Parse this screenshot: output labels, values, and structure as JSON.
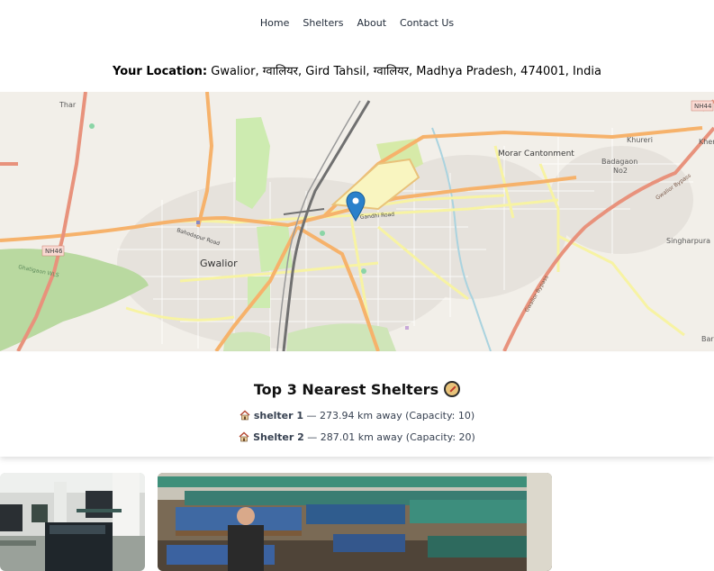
{
  "nav": {
    "home": "Home",
    "shelters": "Shelters",
    "about": "About",
    "contact": "Contact Us"
  },
  "location": {
    "label": "Your Location:",
    "value": "Gwalior, ग्वालियर, Gird Tahsil, ग्वालियर, Madhya Pradesh, 474001, India"
  },
  "map": {
    "labels": {
      "thar": "Thar",
      "nh44": "NH44",
      "khureri": "Khureri",
      "morar_cantonment": "Morar Cantonment",
      "badagaon": "Badagaon",
      "no2": "No2",
      "gwalior_bypass_1": "Gwalior Bypass",
      "singharpura": "Singharpura",
      "gandhi_road": "Gandhi Road",
      "bahodapur_road": "Bahodapur Road",
      "nh46": "NH46",
      "gwalior": "Gwalior",
      "ghatigaon": "Ghatigaon WLS",
      "gwalior_bypass_2": "Gwalior Bypass",
      "khere": "Khere",
      "bar": "Bar"
    }
  },
  "nearest": {
    "title": "Top 3 Nearest Shelters",
    "items": [
      {
        "name": "shelter 1",
        "detail": " — 273.94 km away (Capacity: 10)"
      },
      {
        "name": "Shelter 2",
        "detail": " — 287.01 km away (Capacity: 20)"
      }
    ]
  },
  "colors": {
    "map_bg": "#f2efe9",
    "major_road": "#f6b26b",
    "secondary_road": "#f7f3a3",
    "park": "#cdebb0",
    "marker": "#2a81cb"
  }
}
